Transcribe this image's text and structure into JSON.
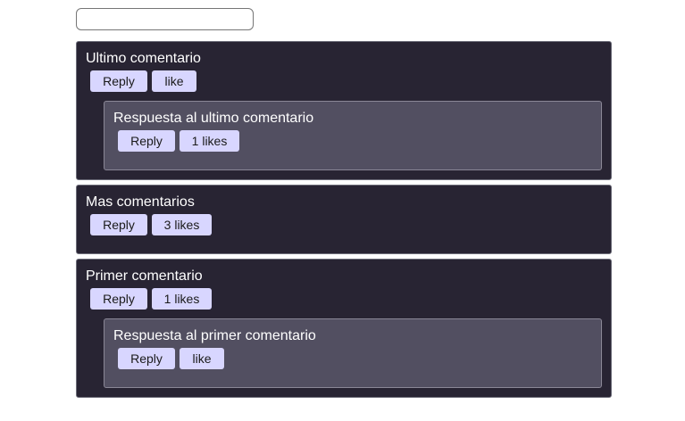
{
  "search": {
    "value": "",
    "placeholder": ""
  },
  "comments": [
    {
      "text": "Ultimo comentario",
      "reply_label": "Reply",
      "like_label": "like",
      "replies": [
        {
          "text": "Respuesta al ultimo comentario",
          "reply_label": "Reply",
          "like_label": "1 likes"
        }
      ]
    },
    {
      "text": "Mas comentarios",
      "reply_label": "Reply",
      "like_label": "3 likes",
      "replies": []
    },
    {
      "text": "Primer comentario",
      "reply_label": "Reply",
      "like_label": "1 likes",
      "replies": [
        {
          "text": "Respuesta al primer comentario",
          "reply_label": "Reply",
          "like_label": "like"
        }
      ]
    }
  ],
  "colors": {
    "comment_bg": "#282433",
    "reply_bg": "#524f61",
    "button_bg": "#d8d6ff",
    "text": "#ffffff"
  }
}
